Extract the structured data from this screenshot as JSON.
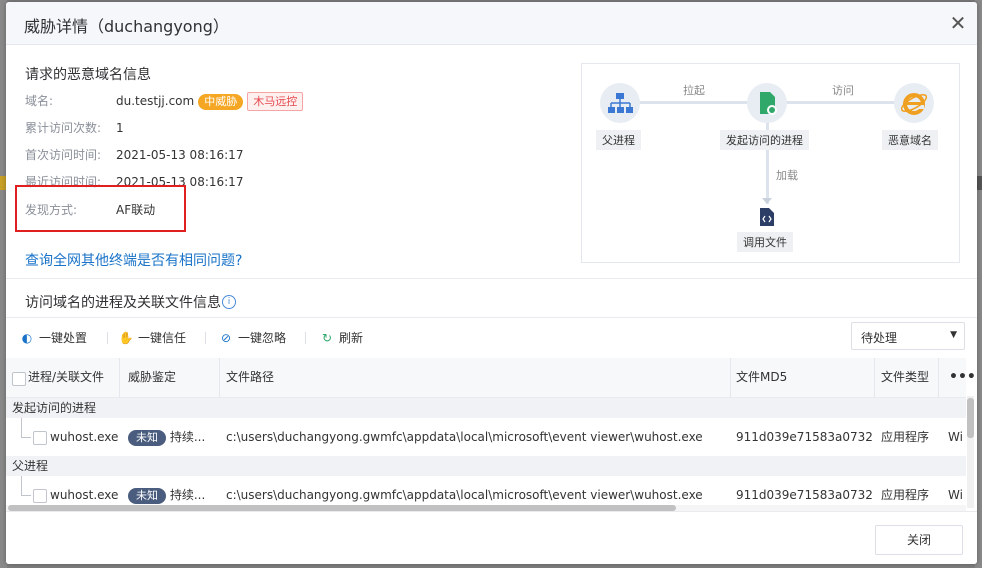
{
  "dialog": {
    "title": "威胁详情（duchangyong）",
    "close_icon": "close-icon"
  },
  "domain_info": {
    "section_title": "请求的恶意域名信息",
    "rows": [
      {
        "label": "域名:",
        "value": "du.testjj.com"
      },
      {
        "label": "累计访问次数:",
        "value": "1"
      },
      {
        "label": "首次访问时间:",
        "value": "2021-05-13 08:16:17"
      },
      {
        "label": "最近访问时间:",
        "value": "2021-05-13 08:16:17"
      },
      {
        "label": "发现方式:",
        "value": "AF联动"
      }
    ],
    "threat_level_tag": "中威胁",
    "threat_type_tag": "木马远控",
    "query_link": "查询全网其他终端是否有相同问题?"
  },
  "graph": {
    "nodes": [
      {
        "label": "父进程",
        "icon": "process-tree-icon"
      },
      {
        "label": "发起访问的进程",
        "icon": "file-gear-icon"
      },
      {
        "label": "恶意域名",
        "icon": "ie-browser-icon"
      },
      {
        "label": "调用文件",
        "icon": "code-file-icon"
      }
    ],
    "edges": [
      "拉起",
      "访问",
      "加载"
    ]
  },
  "process_section": {
    "title": "访问域名的进程及关联文件信息",
    "toolbar": {
      "handle": "一键处置",
      "trust": "一键信任",
      "ignore": "一键忽略",
      "refresh": "刷新"
    },
    "status_select": "待处理"
  },
  "table": {
    "columns": [
      "进程/关联文件",
      "威胁鉴定",
      "文件路径",
      "文件MD5",
      "文件类型"
    ],
    "more_icon": "more-icon",
    "groups": [
      {
        "title": "发起访问的进程",
        "row": {
          "name": "wuhost.exe",
          "badge": "未知",
          "status": "持续...",
          "path": "c:\\users\\duchangyong.gwmfc\\appdata\\local\\microsoft\\event viewer\\wuhost.exe",
          "md5": "911d039e71583a0732...",
          "type": "应用程序",
          "extra": "Wi"
        }
      },
      {
        "title": "父进程",
        "row": {
          "name": "wuhost.exe",
          "badge": "未知",
          "status": "持续...",
          "path": "c:\\users\\duchangyong.gwmfc\\appdata\\local\\microsoft\\event viewer\\wuhost.exe",
          "md5": "911d039e71583a0732...",
          "type": "应用程序",
          "extra": "Wi"
        }
      }
    ]
  },
  "footer": {
    "close_button": "关闭"
  },
  "colors": {
    "accent": "#1a73c8",
    "threat_orange": "#f5a623",
    "trojan_red": "#e5484d",
    "badge_dark": "#4a5d7e",
    "highlight_red": "#e02020"
  }
}
